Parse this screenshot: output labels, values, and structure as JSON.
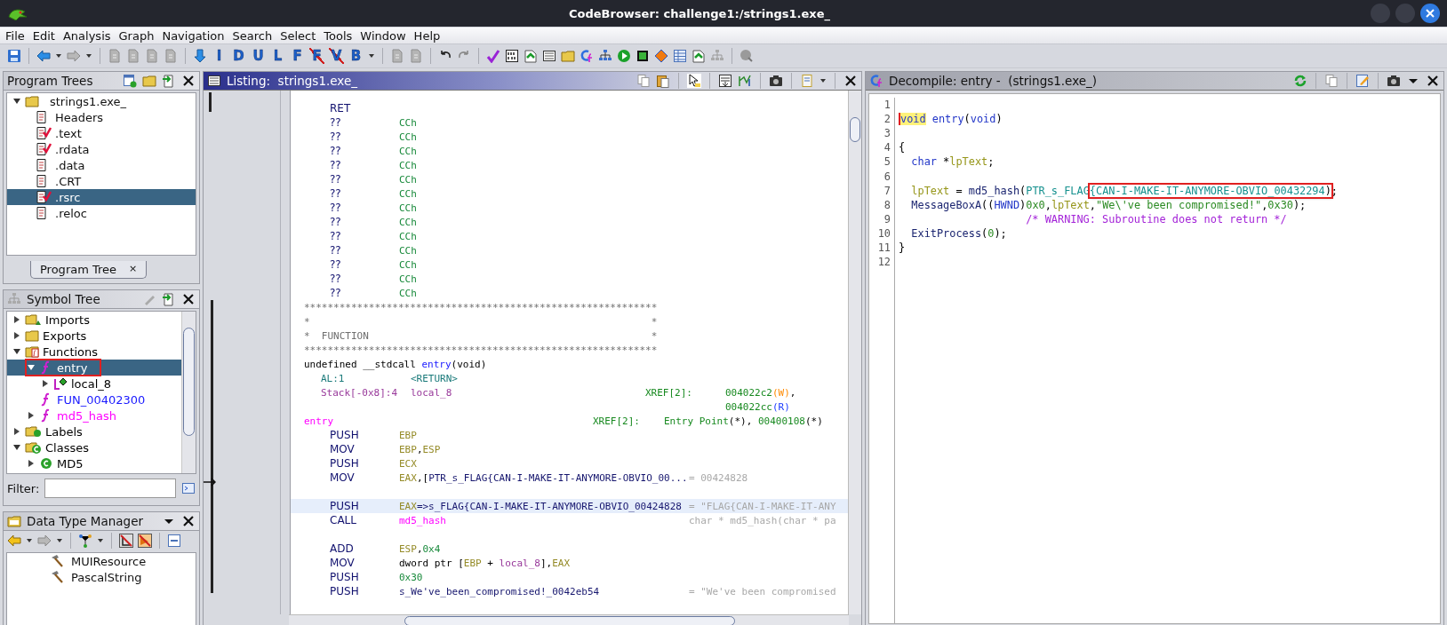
{
  "window": {
    "title": "CodeBrowser: challenge1:/strings1.exe_"
  },
  "menu": [
    "File",
    "Edit",
    "Analysis",
    "Graph",
    "Navigation",
    "Search",
    "Select",
    "Tools",
    "Window",
    "Help"
  ],
  "toolbar": {
    "letters": [
      {
        "text": "I",
        "struck": false
      },
      {
        "text": "D",
        "struck": false
      },
      {
        "text": "U",
        "struck": false
      },
      {
        "text": "L",
        "struck": false
      },
      {
        "text": "F",
        "struck": false
      },
      {
        "text": "F",
        "struck": true
      },
      {
        "text": "V",
        "struck": true
      },
      {
        "text": "B",
        "struck": false
      }
    ]
  },
  "program_trees": {
    "title": "Program Trees",
    "root": {
      "label": "strings1.exe_",
      "expanded": true
    },
    "items": [
      {
        "label": "Headers",
        "modified": false,
        "selected": false
      },
      {
        "label": ".text",
        "modified": true,
        "selected": false
      },
      {
        "label": ".rdata",
        "modified": true,
        "selected": false
      },
      {
        "label": ".data",
        "modified": false,
        "selected": false
      },
      {
        "label": ".CRT",
        "modified": false,
        "selected": false
      },
      {
        "label": ".rsrc",
        "modified": true,
        "selected": true
      },
      {
        "label": ".reloc",
        "modified": false,
        "selected": false
      }
    ],
    "tab": {
      "label": "Program Tree",
      "close": "×"
    }
  },
  "symbol_tree": {
    "title": "Symbol Tree",
    "items": [
      {
        "label": "Imports",
        "kind": "imports",
        "expanded": false,
        "leaf": false,
        "selected": false,
        "boxed": false
      },
      {
        "label": "Exports",
        "kind": "exports",
        "expanded": false,
        "leaf": false,
        "selected": false,
        "boxed": false
      },
      {
        "label": "Functions",
        "kind": "functions",
        "expanded": true,
        "leaf": false,
        "selected": false,
        "boxed": false,
        "children": [
          {
            "label": "entry",
            "kind": "function",
            "expanded": true,
            "leaf": false,
            "selected": true,
            "boxed": true,
            "children": [
              {
                "label": "local_8",
                "kind": "local",
                "expanded": false,
                "leaf": false,
                "selected": false,
                "boxed": false
              }
            ]
          },
          {
            "label": "FUN_00402300",
            "kind": "function",
            "expanded": false,
            "leaf": true,
            "selected": false,
            "boxed": false,
            "color": "#1a1aff"
          },
          {
            "label": "md5_hash",
            "kind": "function",
            "expanded": false,
            "leaf": false,
            "selected": false,
            "boxed": false,
            "color": "#ff00ff"
          }
        ]
      },
      {
        "label": "Labels",
        "kind": "labels",
        "expanded": false,
        "leaf": false,
        "selected": false,
        "boxed": false
      },
      {
        "label": "Classes",
        "kind": "classes",
        "expanded": true,
        "leaf": false,
        "selected": false,
        "boxed": false,
        "children": [
          {
            "label": "MD5",
            "kind": "class",
            "expanded": false,
            "leaf": false,
            "selected": false,
            "boxed": false
          }
        ]
      }
    ],
    "filter": {
      "label": "Filter:"
    }
  },
  "data_type_manager": {
    "title": "Data Type Manager",
    "items": [
      "MUIResource",
      "PascalString"
    ]
  },
  "listing": {
    "title": "Listing:  strings1.exe_",
    "rows": [
      {
        "kind": "instr",
        "mnemonic": "RET",
        "selected": false
      },
      {
        "kind": "instr",
        "mnemonic": "??",
        "operands": [
          {
            "text": "CCh",
            "kind": "num"
          }
        ],
        "selected": false
      },
      {
        "kind": "instr",
        "mnemonic": "??",
        "operands": [
          {
            "text": "CCh",
            "kind": "num"
          }
        ],
        "selected": false
      },
      {
        "kind": "instr",
        "mnemonic": "??",
        "operands": [
          {
            "text": "CCh",
            "kind": "num"
          }
        ],
        "selected": false
      },
      {
        "kind": "instr",
        "mnemonic": "??",
        "operands": [
          {
            "text": "CCh",
            "kind": "num"
          }
        ],
        "selected": false
      },
      {
        "kind": "instr",
        "mnemonic": "??",
        "operands": [
          {
            "text": "CCh",
            "kind": "num"
          }
        ],
        "selected": false
      },
      {
        "kind": "instr",
        "mnemonic": "??",
        "operands": [
          {
            "text": "CCh",
            "kind": "num"
          }
        ],
        "selected": false
      },
      {
        "kind": "instr",
        "mnemonic": "??",
        "operands": [
          {
            "text": "CCh",
            "kind": "num"
          }
        ],
        "selected": false
      },
      {
        "kind": "instr",
        "mnemonic": "??",
        "operands": [
          {
            "text": "CCh",
            "kind": "num"
          }
        ],
        "selected": false
      },
      {
        "kind": "instr",
        "mnemonic": "??",
        "operands": [
          {
            "text": "CCh",
            "kind": "num"
          }
        ],
        "selected": false
      },
      {
        "kind": "instr",
        "mnemonic": "??",
        "operands": [
          {
            "text": "CCh",
            "kind": "num"
          }
        ],
        "selected": false
      },
      {
        "kind": "instr",
        "mnemonic": "??",
        "operands": [
          {
            "text": "CCh",
            "kind": "num"
          }
        ],
        "selected": false
      },
      {
        "kind": "instr",
        "mnemonic": "??",
        "operands": [
          {
            "text": "CCh",
            "kind": "num"
          }
        ],
        "selected": false
      },
      {
        "kind": "instr",
        "mnemonic": "??",
        "operands": [
          {
            "text": "CCh",
            "kind": "num"
          }
        ],
        "selected": false
      },
      {
        "kind": "banner",
        "text": "************************************************************"
      },
      {
        "kind": "banner",
        "text": "*                                                          *"
      },
      {
        "kind": "banner",
        "text": "*  FUNCTION                                                *"
      },
      {
        "kind": "banner",
        "text": "************************************************************"
      },
      {
        "kind": "signature",
        "segments": [
          {
            "text": "undefined __stdcall",
            "kind": "plain"
          },
          {
            "text": " entry",
            "kind": "func"
          },
          {
            "text": "(void)",
            "kind": "plain"
          }
        ]
      },
      {
        "kind": "param",
        "storage": {
          "text": "AL:1",
          "kind": "reg"
        },
        "name": "<RETURN>"
      },
      {
        "kind": "param",
        "storage": {
          "text": "Stack[-0x8]:4",
          "kind": "stack"
        },
        "name": "local_8",
        "xref_label": "XREF[2]:",
        "xrefs": [
          {
            "text": "004022c2",
            "kind": "xref"
          },
          {
            "text": "(W)",
            "kind": "w"
          },
          {
            "text": ",",
            "kind": "plain"
          }
        ]
      },
      {
        "kind": "xref_more",
        "xrefs": [
          {
            "text": "004022cc",
            "kind": "xref"
          },
          {
            "text": "(R)",
            "kind": "r"
          }
        ]
      },
      {
        "kind": "label",
        "label": "entry",
        "xref_label": "XREF[2]:",
        "xrefs": [
          {
            "text": "Entry Point",
            "kind": "xref"
          },
          {
            "text": "(*), ",
            "kind": "plain"
          },
          {
            "text": "00400108",
            "kind": "xref"
          },
          {
            "text": "(*)",
            "kind": "plain"
          }
        ]
      },
      {
        "kind": "instr",
        "mnemonic": "PUSH",
        "operands": [
          {
            "text": "EBP",
            "kind": "reg"
          }
        ],
        "selected": false
      },
      {
        "kind": "instr",
        "mnemonic": "MOV",
        "operands": [
          {
            "text": "EBP",
            "kind": "reg"
          },
          {
            "text": ",",
            "kind": "plain"
          },
          {
            "text": "ESP",
            "kind": "reg"
          }
        ],
        "selected": false
      },
      {
        "kind": "instr",
        "mnemonic": "PUSH",
        "operands": [
          {
            "text": "ECX",
            "kind": "reg"
          }
        ],
        "selected": false
      },
      {
        "kind": "instr",
        "mnemonic": "MOV",
        "operands": [
          {
            "text": "EAX",
            "kind": "reg"
          },
          {
            "text": ",[",
            "kind": "plain"
          },
          {
            "text": "PTR_s_FLAG{CAN-I-MAKE-IT-ANYMORE-OBVIO_00...",
            "kind": "sym"
          }
        ],
        "comment": "= 00424828",
        "selected": false
      },
      {
        "kind": "blank"
      },
      {
        "kind": "instr",
        "mnemonic": "PUSH",
        "operands": [
          {
            "text": "EAX",
            "kind": "reg"
          },
          {
            "text": "=>s_FLAG{CAN-I-MAKE-IT-ANYMORE-OBVIO_00424828",
            "kind": "sym"
          }
        ],
        "comment": "= \"FLAG{CAN-I-MAKE-IT-ANY",
        "selected": true
      },
      {
        "kind": "instr",
        "mnemonic": "CALL",
        "operands": [
          {
            "text": "md5_hash",
            "kind": "label"
          }
        ],
        "comment": "char * md5_hash(char * pa",
        "selected": false
      },
      {
        "kind": "blank"
      },
      {
        "kind": "instr",
        "mnemonic": "ADD",
        "operands": [
          {
            "text": "ESP",
            "kind": "reg"
          },
          {
            "text": ",",
            "kind": "plain"
          },
          {
            "text": "0x4",
            "kind": "num"
          }
        ],
        "selected": false
      },
      {
        "kind": "instr",
        "mnemonic": "MOV",
        "operands": [
          {
            "text": "dword ptr [",
            "kind": "plain"
          },
          {
            "text": "EBP",
            "kind": "reg"
          },
          {
            "text": " + ",
            "kind": "plain"
          },
          {
            "text": "local_8",
            "kind": "local"
          },
          {
            "text": "],",
            "kind": "plain"
          },
          {
            "text": "EAX",
            "kind": "reg"
          }
        ],
        "selected": false
      },
      {
        "kind": "instr",
        "mnemonic": "PUSH",
        "operands": [
          {
            "text": "0x30",
            "kind": "num"
          }
        ],
        "selected": false
      },
      {
        "kind": "instr",
        "mnemonic": "PUSH",
        "operands": [
          {
            "text": "s_We've_been_compromised!_0042eb54",
            "kind": "sym"
          }
        ],
        "comment": "= \"We've been compromised",
        "selected": false
      }
    ]
  },
  "decompile": {
    "title": "Decompile: entry -  (strings1.exe_)",
    "lines": [
      {
        "n": "1"
      },
      {
        "n": "2",
        "segs": [
          {
            "text": "void",
            "kind": "kw",
            "cursor": true
          },
          {
            "text": " entry",
            "kind": "fname"
          },
          {
            "text": "(",
            "kind": "plain"
          },
          {
            "text": "void",
            "kind": "kw"
          },
          {
            "text": ")",
            "kind": "plain"
          }
        ]
      },
      {
        "n": "3"
      },
      {
        "n": "4",
        "segs": [
          {
            "text": "{",
            "kind": "plain"
          }
        ]
      },
      {
        "n": "5",
        "segs": [
          {
            "text": "  char",
            "kind": "kw"
          },
          {
            "text": " *",
            "kind": "plain"
          },
          {
            "text": "lpText",
            "kind": "var"
          },
          {
            "text": ";",
            "kind": "plain"
          }
        ]
      },
      {
        "n": "6"
      },
      {
        "n": "7",
        "segs": [
          {
            "text": "  lpText",
            "kind": "var"
          },
          {
            "text": " = ",
            "kind": "plain"
          },
          {
            "text": "md5_hash",
            "kind": "call"
          },
          {
            "text": "(",
            "kind": "plain"
          },
          {
            "text": "PTR_s_FLAG",
            "kind": "glob"
          },
          {
            "text": "{CAN-I-MAKE-IT-ANYMORE-OBVIO_00432294",
            "kind": "glob",
            "boxed": true
          },
          {
            "text": ")",
            "kind": "plain",
            "boxed": true
          },
          {
            "text": ";",
            "kind": "plain"
          }
        ]
      },
      {
        "n": "8",
        "segs": [
          {
            "text": "  MessageBoxA",
            "kind": "call"
          },
          {
            "text": "((",
            "kind": "plain"
          },
          {
            "text": "HWND",
            "kind": "kw"
          },
          {
            "text": ")",
            "kind": "plain"
          },
          {
            "text": "0x0",
            "kind": "num"
          },
          {
            "text": ",",
            "kind": "plain"
          },
          {
            "text": "lpText",
            "kind": "var"
          },
          {
            "text": ",",
            "kind": "plain"
          },
          {
            "text": "\"We\\'ve been compromised!\"",
            "kind": "str"
          },
          {
            "text": ",",
            "kind": "plain"
          },
          {
            "text": "0x30",
            "kind": "num"
          },
          {
            "text": ");",
            "kind": "plain"
          }
        ]
      },
      {
        "n": "9",
        "segs": [
          {
            "text": "                    /* WARNING: Subroutine does not return */",
            "kind": "cmt"
          }
        ]
      },
      {
        "n": "10",
        "segs": [
          {
            "text": "  ExitProcess",
            "kind": "call"
          },
          {
            "text": "(",
            "kind": "plain"
          },
          {
            "text": "0",
            "kind": "num"
          },
          {
            "text": ");",
            "kind": "plain"
          }
        ]
      },
      {
        "n": "11",
        "segs": [
          {
            "text": "}",
            "kind": "plain"
          }
        ]
      },
      {
        "n": "12"
      }
    ]
  }
}
